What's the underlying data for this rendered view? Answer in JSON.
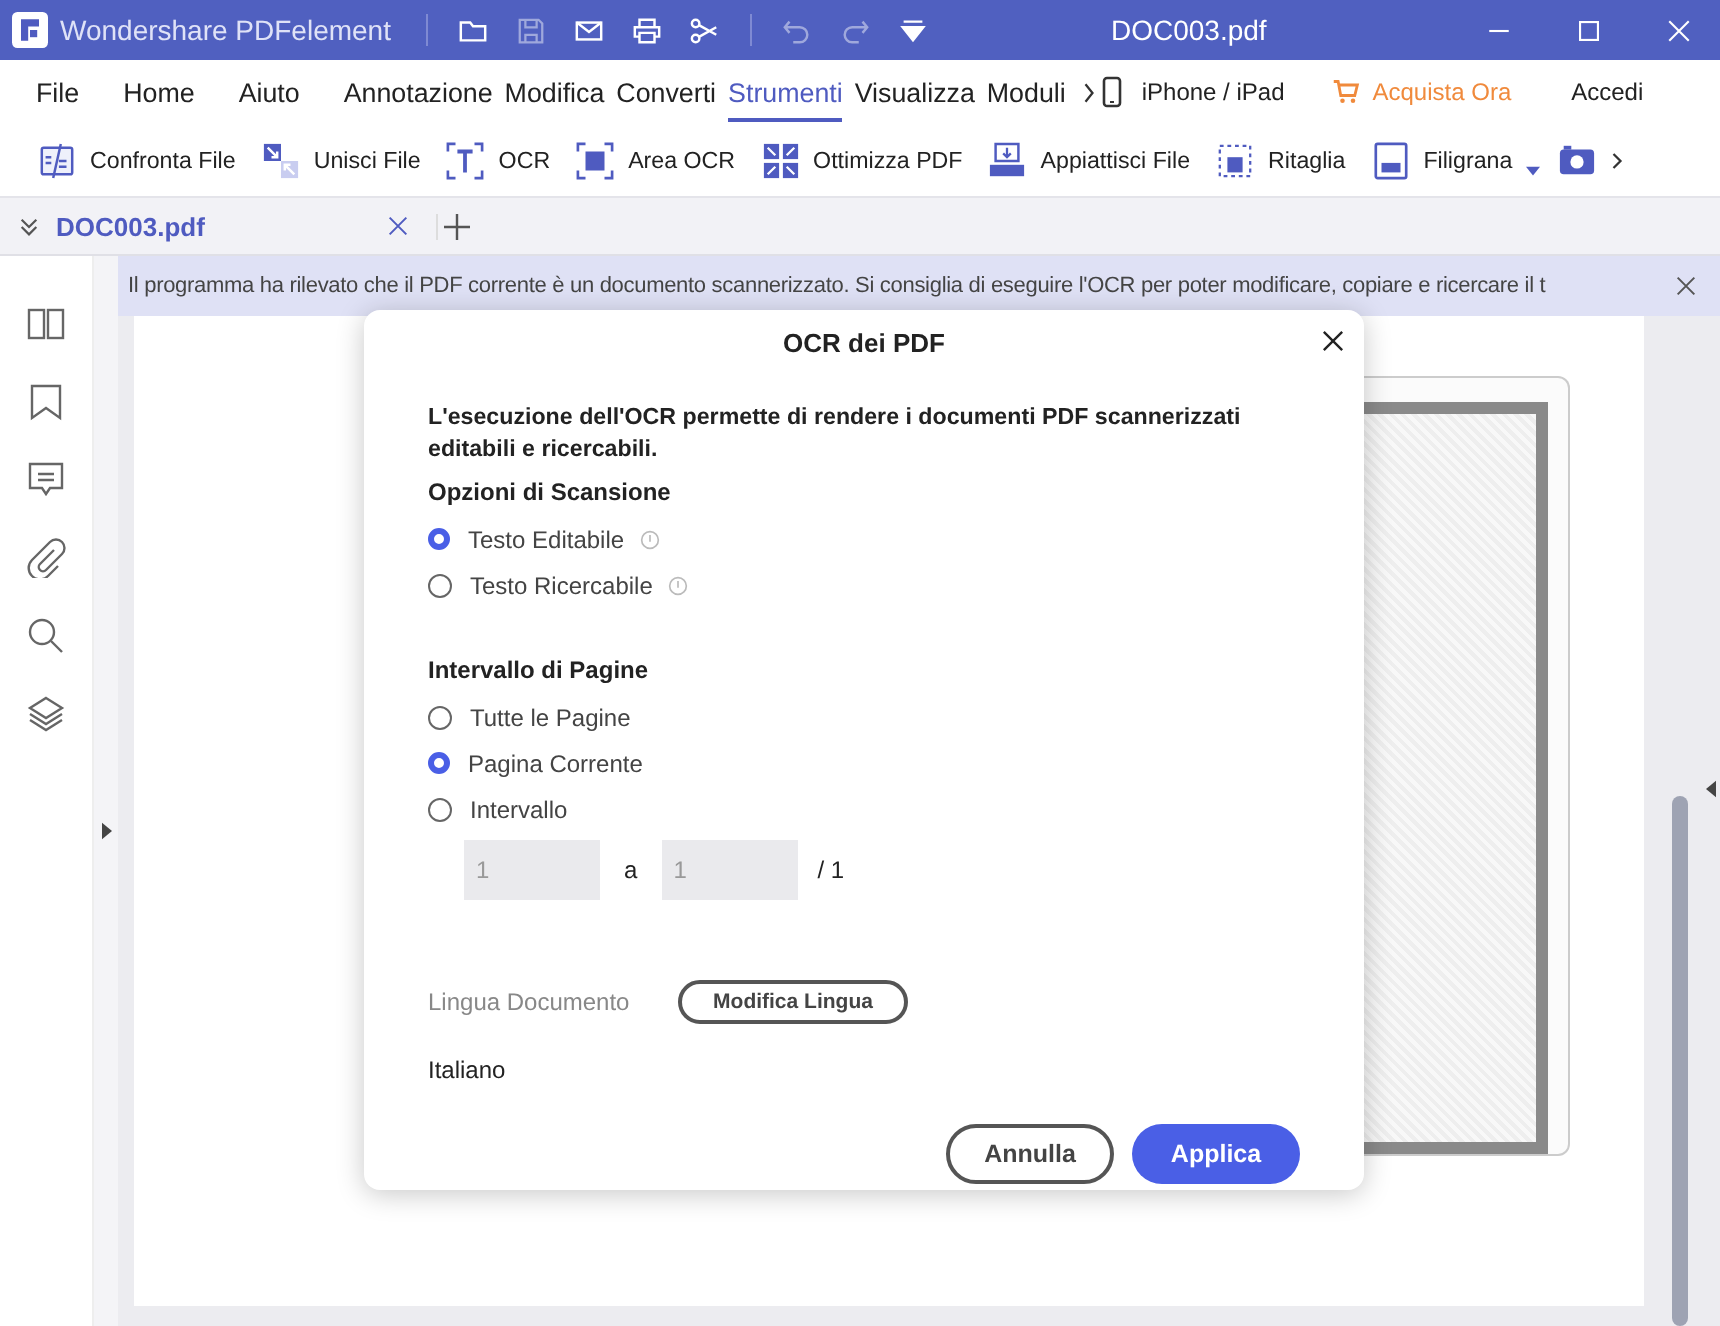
{
  "window": {
    "app_name": "Wondershare PDFelement",
    "title": "DOC003.pdf"
  },
  "menu": {
    "items": [
      {
        "label": "File",
        "selected": false
      },
      {
        "label": "Home",
        "selected": false
      },
      {
        "label": "Aiuto",
        "selected": false
      },
      {
        "label": "Annotazione",
        "selected": false
      },
      {
        "label": "Modifica",
        "selected": false
      },
      {
        "label": "Converti",
        "selected": false
      },
      {
        "label": "Strumenti",
        "selected": true
      },
      {
        "label": "Visualizza",
        "selected": false
      },
      {
        "label": "Moduli",
        "selected": false
      }
    ],
    "device": "iPhone / iPad",
    "buy": "Acquista Ora",
    "login": "Accedi"
  },
  "toolbar": [
    {
      "kind": "compare",
      "label": "Confronta File"
    },
    {
      "kind": "merge",
      "label": "Unisci File"
    },
    {
      "kind": "ocr",
      "label": "OCR"
    },
    {
      "kind": "area",
      "label": "Area OCR"
    },
    {
      "kind": "optimize",
      "label": "Ottimizza PDF"
    },
    {
      "kind": "flatten",
      "label": "Appiattisci File"
    },
    {
      "kind": "crop",
      "label": "Ritaglia"
    },
    {
      "kind": "watermark",
      "label": "Filigrana"
    }
  ],
  "tabs": [
    {
      "label": "DOC003.pdf",
      "selected": true
    }
  ],
  "banner": "Il programma ha rilevato che il PDF corrente è un documento scannerizzato. Si consiglia di eseguire l'OCR per poter modificare, copiare e ricercare il t",
  "dialog": {
    "title": "OCR dei PDF",
    "intro": "L'esecuzione dell'OCR permette di rendere i documenti PDF scannerizzati editabili e ricercabili.",
    "scan_heading": "Opzioni di Scansione",
    "scan_options": [
      {
        "label": "Testo Editabile",
        "selected": true
      },
      {
        "label": "Testo Ricercabile",
        "selected": false
      }
    ],
    "range_heading": "Intervallo di Pagine",
    "range_options": [
      {
        "label": "Tutte le Pagine",
        "selected": false
      },
      {
        "label": "Pagina Corrente",
        "selected": true
      },
      {
        "label": "Intervallo",
        "selected": false
      }
    ],
    "range": {
      "from": "1",
      "separator": "a",
      "to": "1",
      "total": "/ 1",
      "disabled": true
    },
    "language_label": "Lingua Documento",
    "language_button": "Modifica Lingua",
    "language": "Italiano",
    "buttons": [
      {
        "label": "Annulla",
        "kind": "secondary"
      },
      {
        "label": "Applica",
        "kind": "primary"
      }
    ]
  }
}
